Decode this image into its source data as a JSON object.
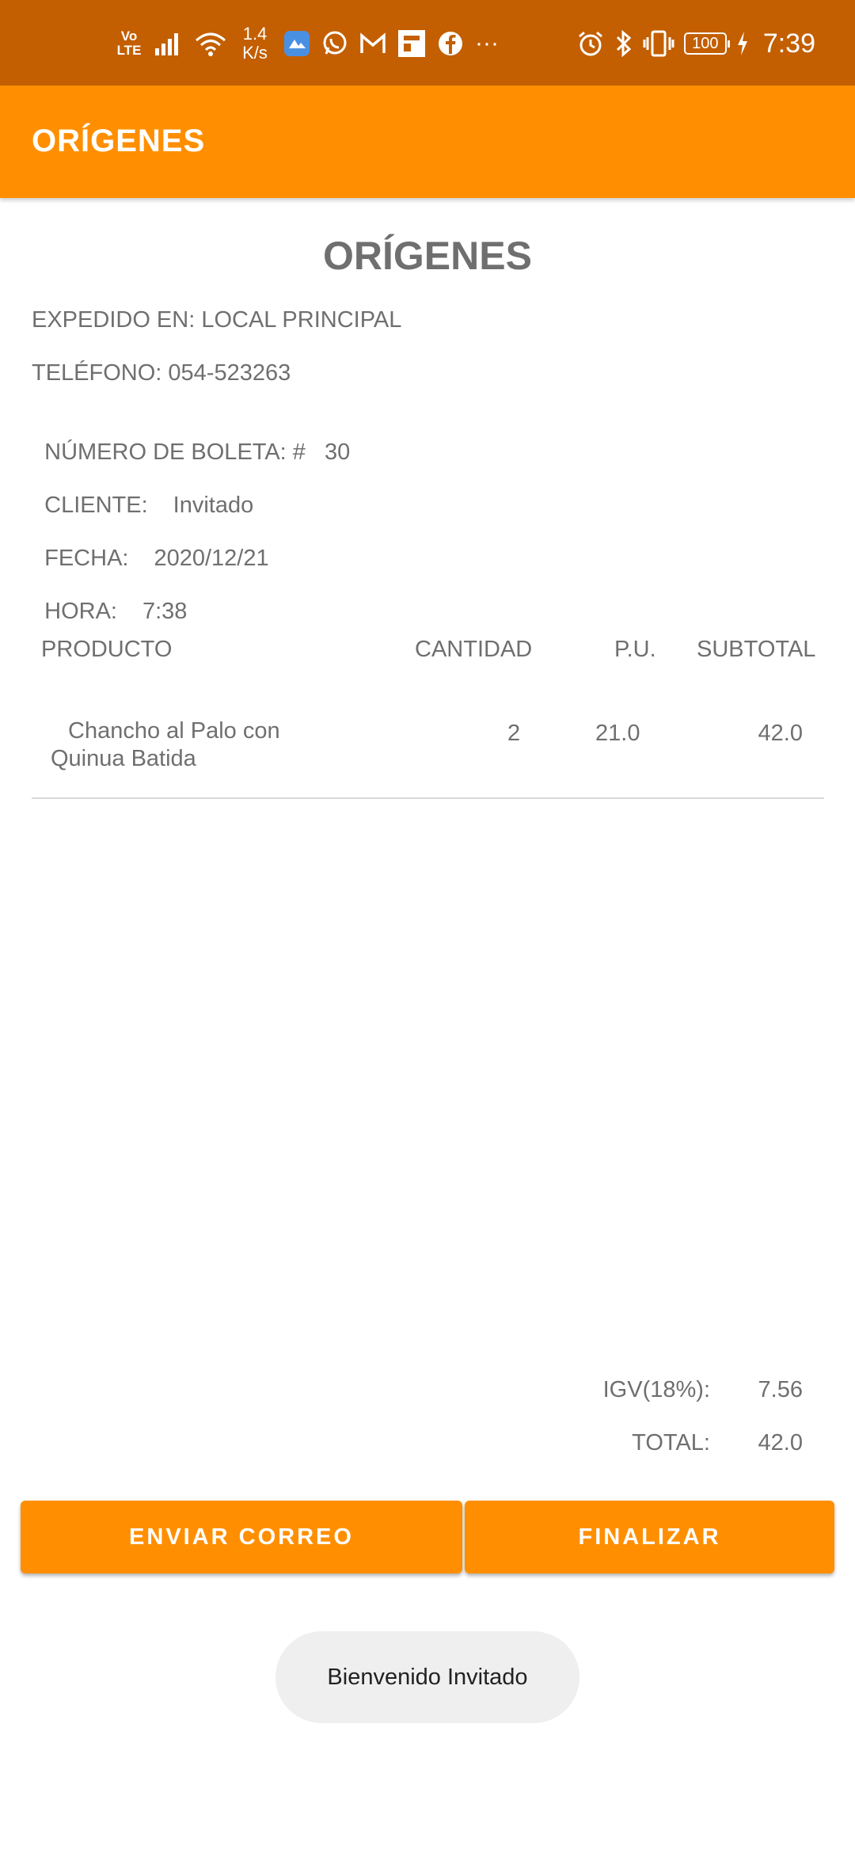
{
  "status_bar": {
    "volte_top": "Vo",
    "volte_bottom": "LTE",
    "net_speed_value": "1.4",
    "net_speed_unit": "K/s",
    "more": "···",
    "battery": "100",
    "time": "7:39"
  },
  "app_bar": {
    "title": "ORÍGENES"
  },
  "receipt": {
    "title": "ORÍGENES",
    "issued_at": "EXPEDIDO EN: LOCAL PRINCIPAL",
    "phone": "TELÉFONO: 054-523263",
    "receipt_number_label": "NÚMERO DE BOLETA: #",
    "receipt_number": "30",
    "client_label": "CLIENTE:",
    "client": "Invitado",
    "date_label": "FECHA:",
    "date": "2020/12/21",
    "time_label": "HORA:",
    "time": "7:38"
  },
  "table": {
    "headers": {
      "product": "PRODUCTO",
      "quantity": "CANTIDAD",
      "unit_price": "P.U.",
      "subtotal": "SUBTOTAL"
    },
    "rows": [
      {
        "product": "Chancho al Palo con Quinua Batida",
        "quantity": "2",
        "unit_price": "21.0",
        "subtotal": "42.0"
      }
    ]
  },
  "totals": {
    "igv_label": "IGV(18%):",
    "igv_value": "7.56",
    "total_label": "TOTAL:",
    "total_value": "42.0"
  },
  "buttons": {
    "send_email": "ENVIAR CORREO",
    "finish": "FINALIZAR"
  },
  "toast": {
    "message": "Bienvenido Invitado"
  },
  "colors": {
    "status_bar": "#c35f00",
    "app_bar": "#ff8f00",
    "button": "#ff8f00"
  }
}
